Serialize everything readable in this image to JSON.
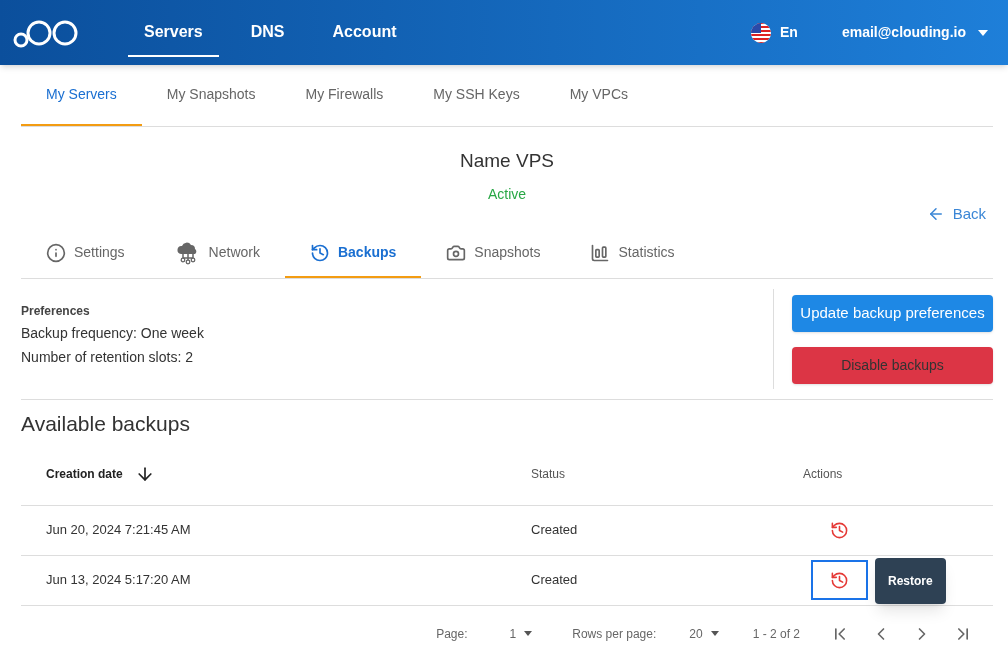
{
  "nav": {
    "items": [
      {
        "label": "Servers",
        "selected": true
      },
      {
        "label": "DNS",
        "selected": false
      },
      {
        "label": "Account",
        "selected": false
      }
    ],
    "language": "En",
    "user": "email@clouding.io"
  },
  "subtabs": [
    {
      "label": "My Servers",
      "selected": true
    },
    {
      "label": "My Snapshots",
      "selected": false
    },
    {
      "label": "My Firewalls",
      "selected": false
    },
    {
      "label": "My SSH Keys",
      "selected": false
    },
    {
      "label": "My VPCs",
      "selected": false
    }
  ],
  "server": {
    "name": "Name VPS",
    "status": "Active",
    "back": "Back"
  },
  "tabs": [
    {
      "label": "Settings",
      "kind": "info",
      "selected": false
    },
    {
      "label": "Network",
      "kind": "network",
      "selected": false
    },
    {
      "label": "Backups",
      "kind": "history",
      "selected": true
    },
    {
      "label": "Snapshots",
      "kind": "camera",
      "selected": false
    },
    {
      "label": "Statistics",
      "kind": "chart",
      "selected": false
    }
  ],
  "preferences": {
    "title": "Preferences",
    "lines": [
      "Backup frequency: One week",
      "Number of retention slots: 2"
    ],
    "update_button": "Update backup preferences",
    "disable_button": "Disable backups"
  },
  "backups": {
    "title": "Available backups",
    "columns": [
      {
        "label": "Creation date",
        "sorted": true,
        "descending": true
      },
      {
        "label": "Status"
      },
      {
        "label": "Actions"
      }
    ],
    "rows": [
      {
        "date": "Jun 20, 2024 7:21:45 AM",
        "status": "Created",
        "focused": false
      },
      {
        "date": "Jun 13, 2024 5:17:20 AM",
        "status": "Created",
        "focused": true,
        "tooltip": "Restore"
      }
    ]
  },
  "pagination": {
    "page_label": "Page:",
    "page": "1",
    "rows_label": "Rows per page:",
    "rows": "20",
    "range": "1 - 2 of 2"
  }
}
